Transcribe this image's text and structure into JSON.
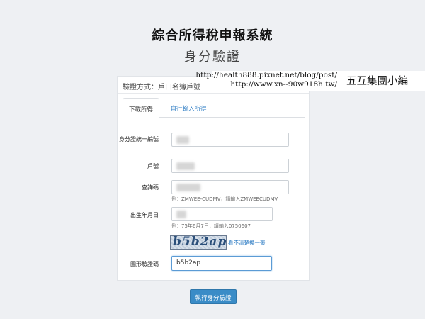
{
  "header": {
    "app_title": "綜合所得稅申報系統",
    "page_subtitle": "身分驗證"
  },
  "watermark": {
    "url1": "http://health888.pixnet.net/blog/post/",
    "url2": "http://www.xn--90w918h.tw/",
    "brand": "五互集團小編"
  },
  "card": {
    "header": "驗證方式：戶口名簿戶號",
    "tabs": [
      {
        "label": "下載所得",
        "active": true
      },
      {
        "label": "自行輸入所得",
        "active": false
      }
    ]
  },
  "form": {
    "id_label": "身分證統一編號",
    "household_label": "戶號",
    "query_code_label": "查詢碼",
    "query_code_hint": "例：ZMWEE-CUDMV，請輸入ZMWEECUDMV",
    "birth_label": "出生年月日",
    "birth_hint": "例：75年6月7日，請輸入0750607",
    "captcha_image_text": "b5b2ap",
    "captcha_refresh": "看不清楚換一張",
    "captcha_label": "圖形驗證碼",
    "captcha_value": "b5b2ap",
    "submit": "執行身分驗證"
  },
  "colors": {
    "background": "#eef0f3",
    "primary_button": "#3a8cc7",
    "link": "#2f7dc4"
  }
}
